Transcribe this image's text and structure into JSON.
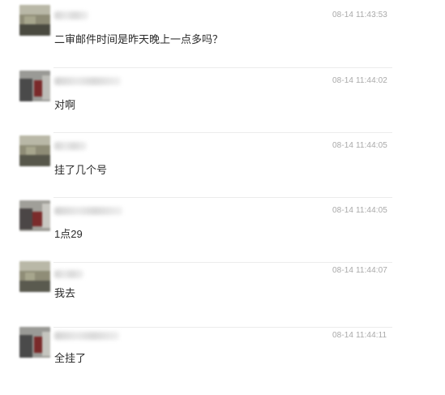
{
  "messages": [
    {
      "time": "08-14 11:43:53",
      "text": "二审邮件时间是昨天晚上一点多吗？"
    },
    {
      "time": "08-14 11:44:02",
      "text": "对啊"
    },
    {
      "time": "08-14 11:44:05",
      "text": "挂了几个号"
    },
    {
      "time": "08-14 11:44:05",
      "text": "1点29"
    },
    {
      "time": "08-14 11:44:07",
      "text": "我去"
    },
    {
      "time": "08-14 11:44:11",
      "text": "全挂了"
    }
  ]
}
